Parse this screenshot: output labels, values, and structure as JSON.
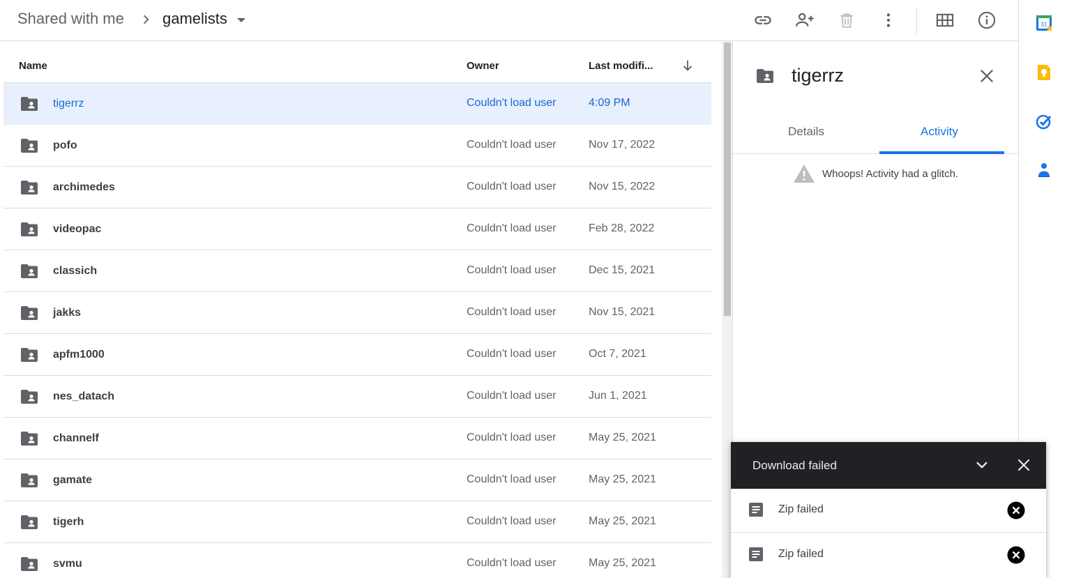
{
  "breadcrumb": {
    "root": "Shared with me",
    "current": "gamelists"
  },
  "toolbar": {
    "icons": [
      "link-icon",
      "add-person-icon",
      "trash-icon",
      "more-vert-icon",
      "grid-view-icon",
      "info-icon"
    ]
  },
  "list": {
    "columns": {
      "name": "Name",
      "owner": "Owner",
      "modified": "Last modifi..."
    },
    "rows": [
      {
        "name": "tigerrz",
        "owner": "Couldn't load user",
        "modified": "4:09 PM",
        "selected": true
      },
      {
        "name": "pofo",
        "owner": "Couldn't load user",
        "modified": "Nov 17, 2022"
      },
      {
        "name": "archimedes",
        "owner": "Couldn't load user",
        "modified": "Nov 15, 2022"
      },
      {
        "name": "videopac",
        "owner": "Couldn't load user",
        "modified": "Feb 28, 2022"
      },
      {
        "name": "classich",
        "owner": "Couldn't load user",
        "modified": "Dec 15, 2021"
      },
      {
        "name": "jakks",
        "owner": "Couldn't load user",
        "modified": "Nov 15, 2021"
      },
      {
        "name": "apfm1000",
        "owner": "Couldn't load user",
        "modified": "Oct 7, 2021"
      },
      {
        "name": "nes_datach",
        "owner": "Couldn't load user",
        "modified": "Jun 1, 2021"
      },
      {
        "name": "channelf",
        "owner": "Couldn't load user",
        "modified": "May 25, 2021"
      },
      {
        "name": "gamate",
        "owner": "Couldn't load user",
        "modified": "May 25, 2021"
      },
      {
        "name": "tigerh",
        "owner": "Couldn't load user",
        "modified": "May 25, 2021"
      },
      {
        "name": "svmu",
        "owner": "Couldn't load user",
        "modified": "May 25, 2021"
      }
    ]
  },
  "panel": {
    "title": "tigerrz",
    "tabs": {
      "details": "Details",
      "activity": "Activity"
    },
    "active_tab": "activity",
    "message": "Whoops! Activity had a glitch."
  },
  "toast": {
    "title": "Download failed",
    "items": [
      {
        "label": "Zip failed"
      },
      {
        "label": "Zip failed"
      }
    ]
  },
  "rail": {
    "apps": [
      "calendar-icon",
      "keep-icon",
      "tasks-icon",
      "contacts-icon"
    ]
  },
  "colors": {
    "accent": "#1a73e8",
    "selected_row": "#e8f0fe",
    "toast_bg": "#202124",
    "keep_yellow": "#fbbc04"
  }
}
